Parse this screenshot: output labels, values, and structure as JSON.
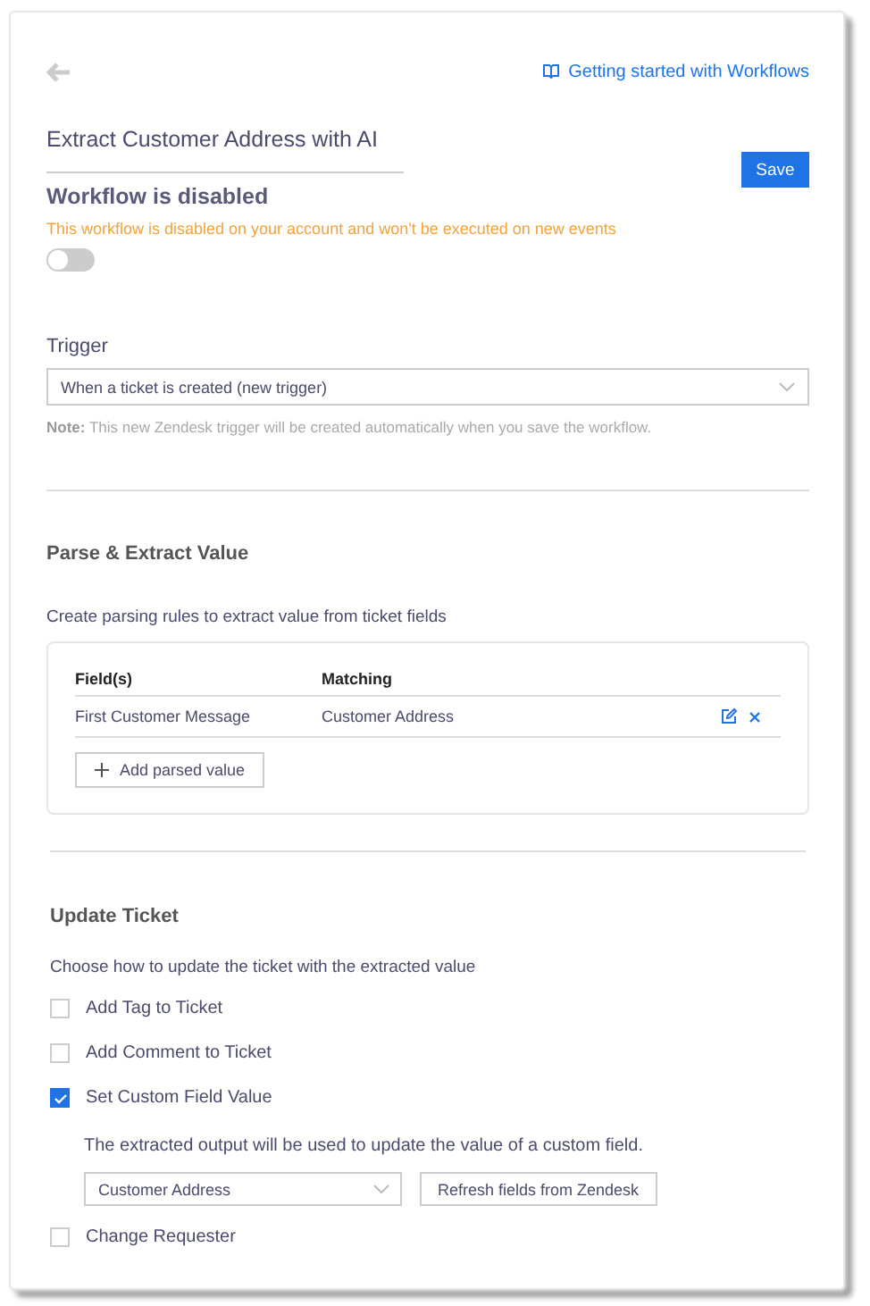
{
  "header": {
    "help_link": "Getting started with Workflows",
    "workflow_name": "Extract Customer Address with AI",
    "save_button": "Save"
  },
  "status": {
    "title": "Workflow is disabled",
    "message": "This workflow is disabled on your account and won't be executed on new events",
    "toggle": {
      "on": false
    }
  },
  "trigger": {
    "label": "Trigger",
    "value": "When a ticket is created (new trigger)",
    "note": "**Note:** This new Zendesk trigger will be created automatically when you save the workflow."
  },
  "parse": {
    "title": "Parse & Extract Value",
    "description": "Create parsing rules to extract value from ticket fields",
    "columns": [
      "Field(s)",
      "Matching"
    ],
    "rows": [
      {
        "field": "First Customer Message",
        "matching": "Customer Address"
      }
    ],
    "add_button": "Add parsed value"
  },
  "update": {
    "title": "Update Ticket",
    "description": "Choose how to update the ticket with the extracted value",
    "options": [
      {
        "label": "Add Tag to Ticket",
        "checked": false
      },
      {
        "label": "Add Comment to Ticket",
        "checked": false
      },
      {
        "label": "Set Custom Field Value",
        "checked": true,
        "detail": "The extracted output will be used to update the value of a custom field.",
        "field_value": "Customer Address",
        "refresh_button": "Refresh fields from Zendesk"
      },
      {
        "label": "Change Requester",
        "checked": false
      }
    ]
  }
}
